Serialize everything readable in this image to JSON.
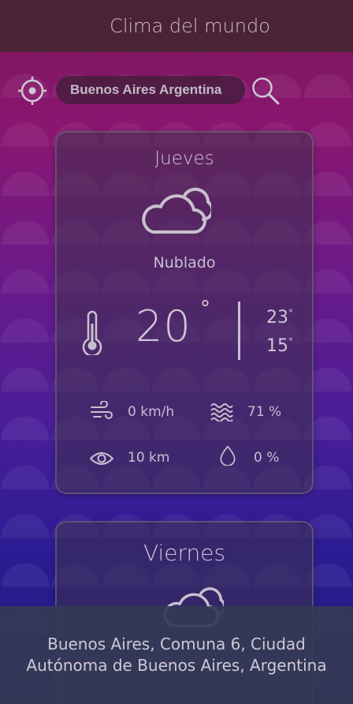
{
  "header": {
    "title": "Clima del mundo"
  },
  "search": {
    "value": "Buenos Aires Argentina",
    "locate_icon": "crosshair-icon",
    "search_icon": "magnifier-icon"
  },
  "forecast": [
    {
      "day": "Jueves",
      "condition": "Nublado",
      "icon": "cloud-icon",
      "temp": "20",
      "temp_unit": "°",
      "max": "23",
      "min": "15",
      "wind": "0 km/h",
      "humidity": "71 %",
      "visibility": "10 km",
      "precipitation": "0 %"
    },
    {
      "day": "Viernes",
      "icon": "cloud-icon"
    }
  ],
  "footer": {
    "location": "Buenos Aires, Comuna 6, Ciudad Autónoma de Buenos Aires, Argentina"
  },
  "colors": {
    "header_bg": "#4c2236",
    "accent_text": "#cfc6d6"
  }
}
